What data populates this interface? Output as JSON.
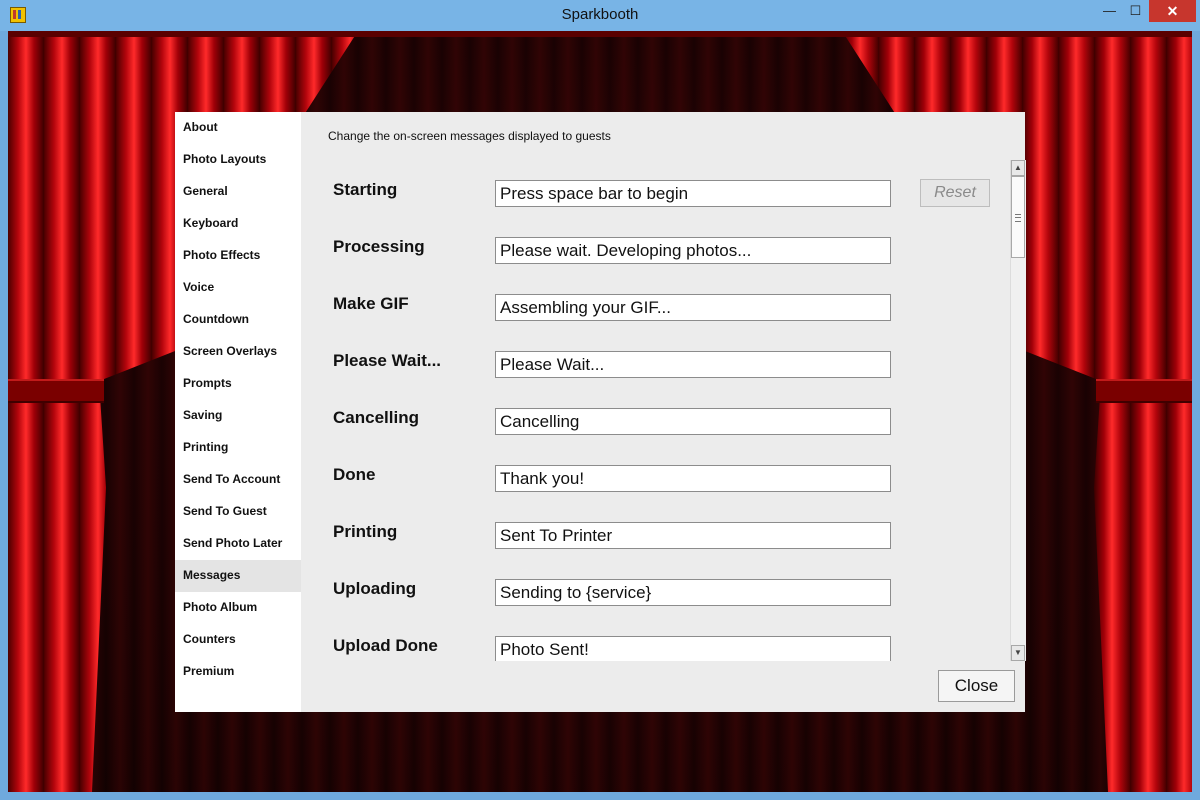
{
  "window": {
    "title": "Sparkbooth",
    "min_glyph": "—",
    "max_glyph": "☐",
    "close_glyph": "✕"
  },
  "sidebar": {
    "items": [
      {
        "label": "About",
        "active": false
      },
      {
        "label": "Photo Layouts",
        "active": false
      },
      {
        "label": "General",
        "active": false
      },
      {
        "label": "Keyboard",
        "active": false
      },
      {
        "label": "Photo Effects",
        "active": false
      },
      {
        "label": "Voice",
        "active": false
      },
      {
        "label": "Countdown",
        "active": false
      },
      {
        "label": "Screen Overlays",
        "active": false
      },
      {
        "label": "Prompts",
        "active": false
      },
      {
        "label": "Saving",
        "active": false
      },
      {
        "label": "Printing",
        "active": false
      },
      {
        "label": "Send To Account",
        "active": false
      },
      {
        "label": "Send To Guest",
        "active": false
      },
      {
        "label": "Send Photo Later",
        "active": false
      },
      {
        "label": "Messages",
        "active": true
      },
      {
        "label": "Photo Album",
        "active": false
      },
      {
        "label": "Counters",
        "active": false
      },
      {
        "label": "Premium",
        "active": false
      }
    ]
  },
  "messages": {
    "intro": "Change the on-screen messages displayed to guests",
    "reset_label": "Reset",
    "rows": [
      {
        "label": "Starting",
        "value": "Press space bar to begin"
      },
      {
        "label": "Processing",
        "value": "Please wait. Developing photos..."
      },
      {
        "label": "Make GIF",
        "value": "Assembling your GIF..."
      },
      {
        "label": "Please Wait...",
        "value": "Please Wait..."
      },
      {
        "label": "Cancelling",
        "value": "Cancelling"
      },
      {
        "label": "Done",
        "value": "Thank you!"
      },
      {
        "label": "Printing",
        "value": "Sent To Printer"
      },
      {
        "label": "Uploading",
        "value": "Sending to {service}"
      },
      {
        "label": "Upload Done",
        "value": "Photo Sent!"
      }
    ]
  },
  "scrollbar": {
    "up_glyph": "▲",
    "down_glyph": "▼"
  },
  "footer": {
    "close_label": "Close"
  }
}
